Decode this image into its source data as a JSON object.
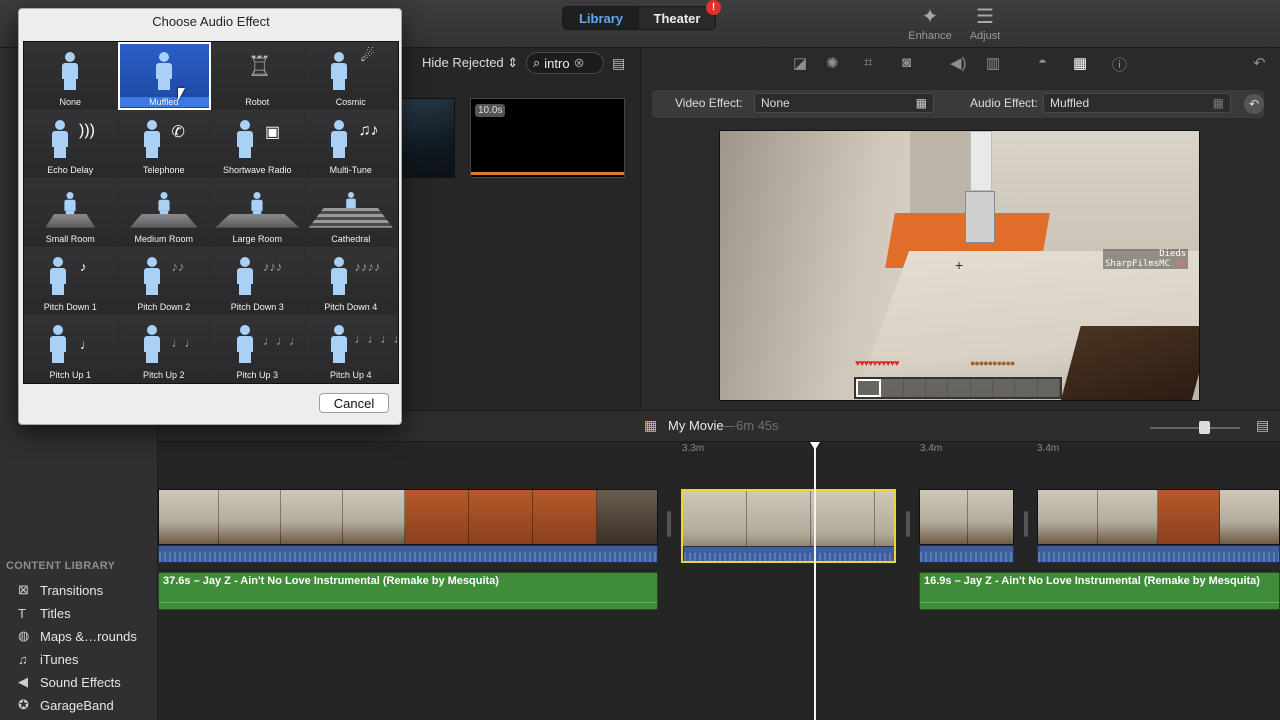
{
  "toolbar": {
    "library_label": "Library",
    "theater_label": "Theater",
    "theater_badge": "!",
    "enhance_label": "Enhance",
    "adjust_label": "Adjust"
  },
  "browser": {
    "filter_label": "Hide Rejected",
    "search_value": "intro",
    "thumb_duration": "10.0s"
  },
  "viewer": {
    "video_effect_label": "Video Effect:",
    "video_effect_value": "None",
    "audio_effect_label": "Audio Effect:",
    "audio_effect_value": "Muffled",
    "overlay_names_line1": "Dieds",
    "overlay_names_line2": "SharpFilmsMC",
    "overlay_ping": "36"
  },
  "dialog": {
    "title": "Choose Audio Effect",
    "cancel_label": "Cancel",
    "effects": [
      "None",
      "Muffled",
      "Robot",
      "Cosmic",
      "Echo Delay",
      "Telephone",
      "Shortwave Radio",
      "Multi-Tune",
      "Small Room",
      "Medium Room",
      "Large Room",
      "Cathedral",
      "Pitch Down 1",
      "Pitch Down 2",
      "Pitch Down 3",
      "Pitch Down 4",
      "Pitch Up 1",
      "Pitch Up 2",
      "Pitch Up 3",
      "Pitch Up 4"
    ],
    "selected": "Muffled"
  },
  "timeline": {
    "title": "My Movie",
    "duration": "6m 45s",
    "ruler": [
      "3.3m",
      "3.4m",
      "3.4m"
    ],
    "music_clips": [
      "37.6s – Jay Z - Ain't No Love Instrumental (Remake by Mesquita)",
      "16.9s – Jay Z - Ain't No Love Instrumental (Remake by Mesquita)"
    ]
  },
  "content_library": {
    "title": "CONTENT LIBRARY",
    "items": [
      "Transitions",
      "Titles",
      "Maps &…rounds",
      "iTunes",
      "Sound Effects",
      "GarageBand"
    ]
  },
  "colors": {
    "accent": "#5fa8f5",
    "selection": "#f1d23b",
    "music_clip": "#3f8d3a",
    "audio_wave": "#3e5f9a"
  }
}
